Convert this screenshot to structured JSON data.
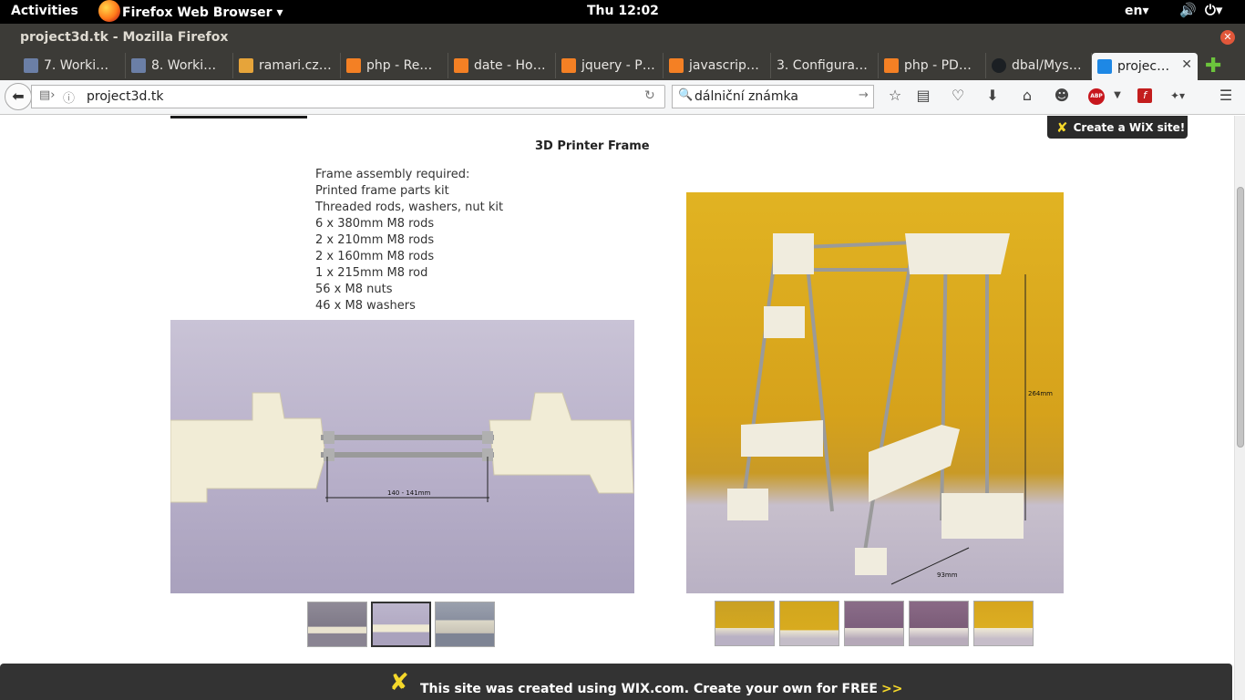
{
  "system": {
    "activities": "Activities",
    "app_menu": "Firefox Web Browser ▾",
    "clock": "Thu 12:02",
    "language": "en▾",
    "volume_icon": "volume-icon",
    "power_icon": "power-icon"
  },
  "window": {
    "title": "project3d.tk - Mozilla Firefox"
  },
  "tabs": [
    {
      "label": "7. Worki…",
      "icon_color": "#6b7fa6"
    },
    {
      "label": "8. Worki…",
      "icon_color": "#6b7fa6"
    },
    {
      "label": "ramari.cz…",
      "icon_color": "#e6a43a"
    },
    {
      "label": "php - Re…",
      "icon_color": "#f48024"
    },
    {
      "label": "date - Ho…",
      "icon_color": "#f48024"
    },
    {
      "label": "jquery - P…",
      "icon_color": "#f48024"
    },
    {
      "label": "javascrip…",
      "icon_color": "#f48024"
    },
    {
      "label": "3. Configura…",
      "icon_color": "#3c3b37"
    },
    {
      "label": "php - PD…",
      "icon_color": "#f48024"
    },
    {
      "label": "dbal/Mys…",
      "icon_color": "#1b1f23"
    },
    {
      "label": "projec…",
      "icon_color": "#1e88e5"
    }
  ],
  "nav": {
    "url": "project3d.tk",
    "search_value": "dálniční známka"
  },
  "page": {
    "heading": "3D Printer Frame",
    "description": [
      "Frame assembly required:",
      "Printed frame parts kit",
      "Threaded rods, washers, nut kit",
      "6 x 380mm M8 rods",
      "2 x 210mm M8 rods",
      "2 x 160mm M8 rods",
      "1 x 215mm M8 rod",
      "56 x M8 nuts",
      "46 x M8 washers"
    ],
    "photo_left_label": "140 - 141mm",
    "photo_right_label_height": "264mm",
    "photo_right_label_width": "93mm",
    "wix_badge": "Create a WiX site!",
    "wix_footer": "This site was created using WIX.com. Create your own for FREE",
    "wix_footer_arrow": ">>"
  }
}
